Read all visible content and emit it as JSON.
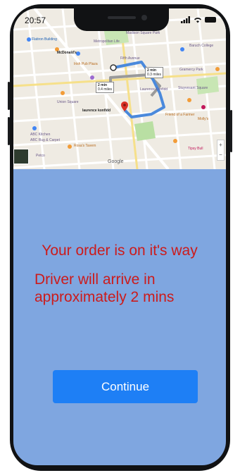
{
  "status_bar": {
    "time": "20:57"
  },
  "map": {
    "route_duration_primary": "2 min",
    "route_sub_primary": "0.3 miles",
    "route_duration_alt": "2 min",
    "route_sub_alt": "0.4 miles",
    "destination_label": "laurence konfidd",
    "provider": "Google",
    "zoom_in": "+",
    "zoom_out": "−",
    "places": [
      "Flatiron Building",
      "McDonald's",
      "Metropolitan Life",
      "Fifth Avenue",
      "Irish Pub Plaza",
      "Madison Square Park",
      "Laurence Konfidd",
      "Baruch College",
      "Gramercy Park",
      "Stuyvesant Square",
      "Union Square",
      "Molly's",
      "ABC Kitchen",
      "ABC Rug & Carpet",
      "Petco",
      "Rosa's Tavern",
      "Friend of a Farmer",
      "Tipsy Bull"
    ]
  },
  "order": {
    "headline": "Your order is on it's way",
    "driver_message": "Driver will arrive in approximately 2 mins"
  },
  "actions": {
    "continue_label": "Continue"
  },
  "colors": {
    "screen_background": "#7fa6e0",
    "message_text": "#cc1b1b",
    "button_background": "#1e7ff5",
    "route_primary": "#4a89dc",
    "route_alt": "#9a9a9a"
  },
  "icons": {
    "signal": "signal-icon",
    "wifi": "wifi-icon",
    "battery": "battery-icon",
    "destination_pin": "location-pin-icon"
  }
}
